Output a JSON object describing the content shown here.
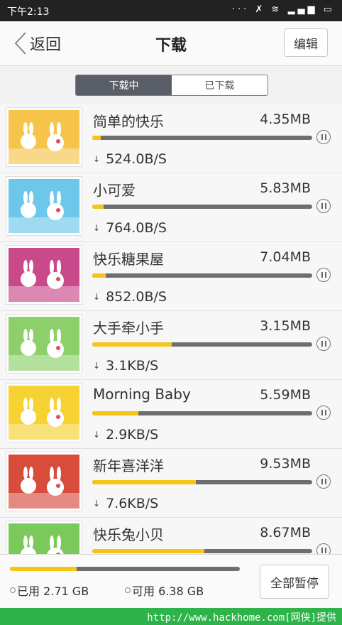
{
  "status_bar": {
    "time": "下午2:13",
    "icons": [
      "signal-dots-icon",
      "mute-icon",
      "wifi-icon",
      "cell-signal-icon",
      "battery-icon"
    ]
  },
  "header": {
    "back_label": "返回",
    "title": "下载",
    "edit_label": "编辑"
  },
  "tabs": {
    "downloading": "下载中",
    "downloaded": "已下载",
    "active": "downloading"
  },
  "colors": {
    "accent": "#f5c518",
    "track": "#6e6e6e",
    "watermark": "#2db34a"
  },
  "downloads": [
    {
      "title": "简单的快乐",
      "size": "4.35MB",
      "speed": "524.0B/S",
      "progress": 0.04,
      "thumb_color": "#f7c44a",
      "thumb_caption": "简单的快乐"
    },
    {
      "title": "小可爱",
      "size": "5.83MB",
      "speed": "764.0B/S",
      "progress": 0.05,
      "thumb_color": "#6dc7ea",
      "thumb_caption": "小可爱"
    },
    {
      "title": "快乐糖果屋",
      "size": "7.04MB",
      "speed": "852.0B/S",
      "progress": 0.06,
      "thumb_color": "#c84a8a",
      "thumb_caption": "快乐糖果屋"
    },
    {
      "title": "大手牵小手",
      "size": "3.15MB",
      "speed": "3.1KB/S",
      "progress": 0.36,
      "thumb_color": "#8dcf6a",
      "thumb_caption": "大手牵小手"
    },
    {
      "title": "Morning Baby",
      "size": "5.59MB",
      "speed": "2.9KB/S",
      "progress": 0.21,
      "thumb_color": "#f6d233",
      "thumb_caption": "Morning Baby"
    },
    {
      "title": "新年喜洋洋",
      "size": "9.53MB",
      "speed": "7.6KB/S",
      "progress": 0.47,
      "thumb_color": "#d84c3c",
      "thumb_caption": "新年喜洋洋"
    },
    {
      "title": "快乐兔小贝",
      "size": "8.67MB",
      "speed": "",
      "progress": 0.51,
      "thumb_color": "#7bc95a",
      "thumb_caption": "快乐兔小贝"
    }
  ],
  "footer": {
    "used_label": "已用 2.71 GB",
    "free_label": "可用 6.38 GB",
    "used_fraction": 0.29,
    "pause_all_label": "全部暂停"
  },
  "watermark": {
    "text": "http://www.hackhome.com[网侠]提供"
  }
}
